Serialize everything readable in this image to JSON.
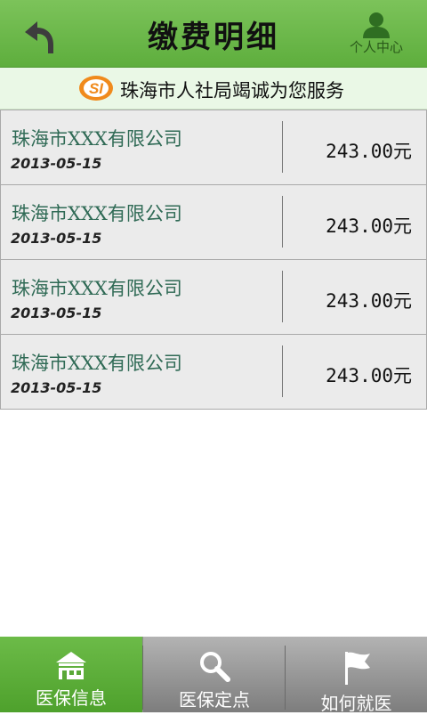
{
  "header": {
    "title": "缴费明细",
    "user_label": "个人中心",
    "back_icon": "back-arrow-icon",
    "user_icon": "person-icon",
    "color": "#6bbb4a"
  },
  "banner": {
    "logo_text": "SI",
    "text": "珠海市人社局竭诚为您服务"
  },
  "records": [
    {
      "company": "珠海市XXX有限公司",
      "date": "2013-05-15",
      "amount": "243.00元"
    },
    {
      "company": "珠海市XXX有限公司",
      "date": "2013-05-15",
      "amount": "243.00元"
    },
    {
      "company": "珠海市XXX有限公司",
      "date": "2013-05-15",
      "amount": "243.00元"
    },
    {
      "company": "珠海市XXX有限公司",
      "date": "2013-05-15",
      "amount": "243.00元"
    }
  ],
  "tabs": [
    {
      "label": "医保信息",
      "icon": "house-icon",
      "active": true
    },
    {
      "label": "医保定点",
      "icon": "magnifier-icon",
      "active": false
    },
    {
      "label": "如何就医",
      "icon": "flag-icon",
      "active": false
    }
  ]
}
